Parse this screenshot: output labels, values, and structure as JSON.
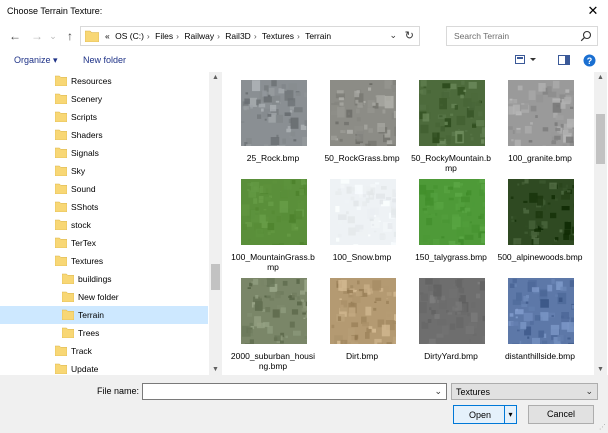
{
  "window": {
    "title": "Choose Terrain Texture:",
    "close_glyph": "✕"
  },
  "nav": {
    "back_glyph": "←",
    "forward_glyph": "→",
    "dropdown_glyph": "⌄",
    "up_glyph": "↑",
    "breadcrumb": [
      "«",
      "OS (C:)",
      "Files",
      "Railway",
      "Rail3D",
      "Textures",
      "Terrain"
    ],
    "separator": "›",
    "address_dropdown_glyph": "⌄",
    "refresh_glyph": "↻",
    "search_placeholder": "Search Terrain"
  },
  "toolbar": {
    "organize_label": "Organize ▾",
    "new_folder_label": "New folder",
    "view_icon": "view-icon",
    "help_glyph": "?"
  },
  "sidebar": {
    "items": [
      {
        "label": "Resources",
        "indent": 1
      },
      {
        "label": "Scenery",
        "indent": 1
      },
      {
        "label": "Scripts",
        "indent": 1
      },
      {
        "label": "Shaders",
        "indent": 1
      },
      {
        "label": "Signals",
        "indent": 1
      },
      {
        "label": "Sky",
        "indent": 1
      },
      {
        "label": "Sound",
        "indent": 1
      },
      {
        "label": "SShots",
        "indent": 1
      },
      {
        "label": "stock",
        "indent": 1
      },
      {
        "label": "TerTex",
        "indent": 1
      },
      {
        "label": "Textures",
        "indent": 1
      },
      {
        "label": "buildings",
        "indent": 2
      },
      {
        "label": "New folder",
        "indent": 2
      },
      {
        "label": "Terrain",
        "indent": 2,
        "selected": true
      },
      {
        "label": "Trees",
        "indent": 2
      },
      {
        "label": "Track",
        "indent": 1
      },
      {
        "label": "Update",
        "indent": 1
      }
    ]
  },
  "files": [
    {
      "name": "25_Rock.bmp",
      "texture": "rock",
      "color": "#8a8f93"
    },
    {
      "name": "50_RockGrass.bmp",
      "texture": "rockgrass",
      "color": "#8c8c86"
    },
    {
      "name": "50_RockyMountain.bmp",
      "texture": "rockymountain",
      "color": "#4d6b3c"
    },
    {
      "name": "100_granite.bmp",
      "texture": "granite",
      "color": "#9a9a9a"
    },
    {
      "name": "100_MountainGrass.bmp",
      "texture": "mountaingrass",
      "color": "#5a8f3a"
    },
    {
      "name": "100_Snow.bmp",
      "texture": "snow",
      "color": "#eef2f5"
    },
    {
      "name": "150_talygrass.bmp",
      "texture": "talygrass",
      "color": "#4e9a38"
    },
    {
      "name": "500_alpinewoods.bmp",
      "texture": "alpinewoods",
      "color": "#2f4a22"
    },
    {
      "name": "2000_suburban_housing.bmp",
      "texture": "suburban",
      "color": "#7a8668"
    },
    {
      "name": "Dirt.bmp",
      "texture": "dirt",
      "color": "#b49a72"
    },
    {
      "name": "DirtyYard.bmp",
      "texture": "dirtyyard",
      "color": "#6e6e6e"
    },
    {
      "name": "distanthillside.bmp",
      "texture": "hillside",
      "color": "#5d78a8"
    }
  ],
  "bottom": {
    "file_name_label": "File name:",
    "file_name_value": "",
    "file_name_dropdown_glyph": "⌄",
    "filter_value": "Textures",
    "filter_dropdown_glyph": "⌄",
    "open_label": "Open",
    "open_split_glyph": "▾",
    "cancel_label": "Cancel"
  },
  "colors": {
    "accent": "#0078d7",
    "folder": "#f8d775",
    "selection": "#cde8ff",
    "link": "#1e3287"
  }
}
